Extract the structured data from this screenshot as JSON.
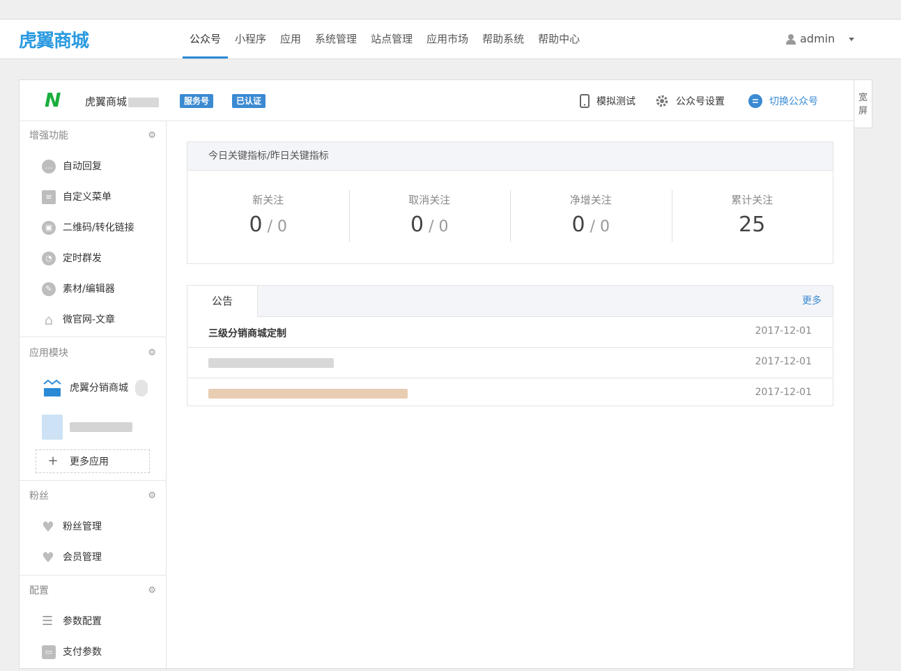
{
  "header": {
    "logo_text": "虎翼商城",
    "nav": [
      {
        "label": "公众号",
        "active": true
      },
      {
        "label": "小程序"
      },
      {
        "label": "应用"
      },
      {
        "label": "系统管理"
      },
      {
        "label": "站点管理"
      },
      {
        "label": "应用市场"
      },
      {
        "label": "帮助系统"
      },
      {
        "label": "帮助中心"
      }
    ],
    "user": "admin"
  },
  "wide_toggle": "宽屏",
  "account": {
    "logo_letter": "N",
    "name": "虎翼商城",
    "badge_service": "服务号",
    "badge_verified": "已认证",
    "tool_simulate": "模拟测试",
    "tool_settings": "公众号设置",
    "tool_switch": "切换公众号"
  },
  "sidebar": {
    "enhance": {
      "title": "增强功能",
      "items": [
        "自动回复",
        "自定义菜单",
        "二维码/转化链接",
        "定时群发",
        "素材/编辑器",
        "微官网-文章"
      ]
    },
    "modules": {
      "title": "应用模块",
      "items": [
        "虎翼分销商城"
      ],
      "more": "更多应用"
    },
    "fans": {
      "title": "粉丝",
      "items": [
        "粉丝管理",
        "会员管理"
      ]
    },
    "config": {
      "title": "配置",
      "items": [
        "参数配置",
        "支付参数"
      ]
    }
  },
  "kpi": {
    "title": "今日关键指标/昨日关键指标",
    "cols": [
      {
        "label": "新关注",
        "today": "0",
        "yesterday": "0"
      },
      {
        "label": "取消关注",
        "today": "0",
        "yesterday": "0"
      },
      {
        "label": "净增关注",
        "today": "0",
        "yesterday": "0"
      },
      {
        "label": "累计关注",
        "today": "25"
      }
    ]
  },
  "notice": {
    "tab": "公告",
    "more": "更多",
    "rows": [
      {
        "title": "三级分销商城定制",
        "date": "2017-12-01"
      },
      {
        "title": "",
        "date": "2017-12-01"
      },
      {
        "title": "",
        "date": "2017-12-01"
      }
    ]
  },
  "colors": {
    "accent": "#3b8ad2",
    "logo": "#2a9ae0",
    "wechat_green": "#1aae3c"
  }
}
